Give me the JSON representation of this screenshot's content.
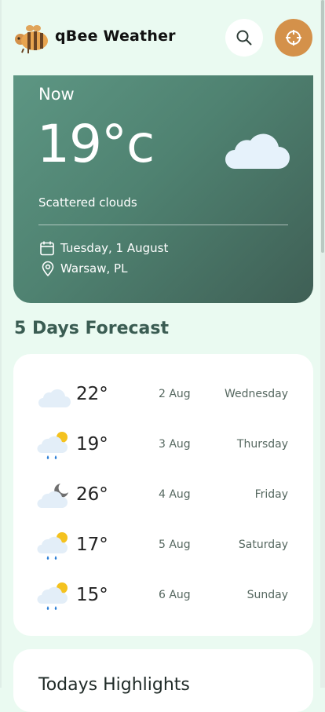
{
  "header": {
    "app_title": "qBee Weather",
    "logo_icon": "bee-icon",
    "search_icon": "search-icon",
    "location_icon": "crosshair-icon",
    "accent_color": "#d4914a"
  },
  "current": {
    "label": "Now",
    "temperature": "19°c",
    "description": "Scattered clouds",
    "date": "Tuesday, 1 August",
    "location": "Warsaw, PL",
    "weather_icon": "cloud-icon",
    "date_icon": "calendar-icon",
    "location_pin_icon": "location-pin-icon"
  },
  "forecast": {
    "title": "5 Days Forecast",
    "days": [
      {
        "temp": "22°",
        "date": "2 Aug",
        "day": "Wednesday",
        "icon": "cloud-icon"
      },
      {
        "temp": "19°",
        "date": "3 Aug",
        "day": "Thursday",
        "icon": "sun-cloud-rain-icon"
      },
      {
        "temp": "26°",
        "date": "4 Aug",
        "day": "Friday",
        "icon": "moon-cloud-icon"
      },
      {
        "temp": "17°",
        "date": "5 Aug",
        "day": "Saturday",
        "icon": "sun-cloud-rain-icon"
      },
      {
        "temp": "15°",
        "date": "6 Aug",
        "day": "Sunday",
        "icon": "sun-cloud-rain-icon"
      }
    ]
  },
  "highlights": {
    "title": "Todays Highlights"
  }
}
